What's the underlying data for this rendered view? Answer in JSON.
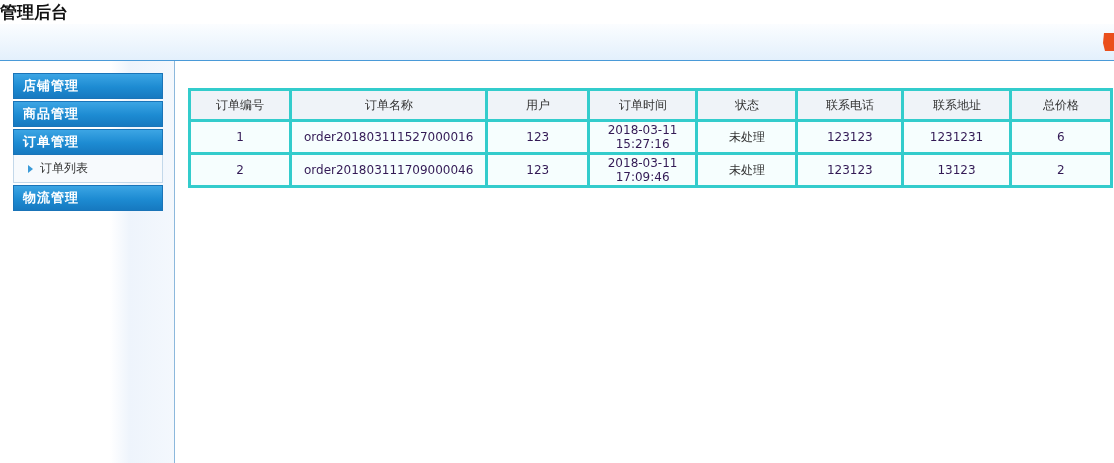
{
  "window": {
    "title": "管理后台"
  },
  "sidebar": {
    "groups": [
      {
        "label": "店铺管理"
      },
      {
        "label": "商品管理"
      },
      {
        "label": "订单管理",
        "children": [
          {
            "label": "订单列表"
          }
        ]
      },
      {
        "label": "物流管理"
      }
    ]
  },
  "table": {
    "columns": [
      "订单编号",
      "订单名称",
      "用户",
      "订单时间",
      "状态",
      "联系电话",
      "联系地址",
      "总价格"
    ],
    "rows": [
      [
        "1",
        "order201803111527000016",
        "123",
        "2018-03-11 15:27:16",
        "未处理",
        "123123",
        "1231231",
        "6"
      ],
      [
        "2",
        "order201803111709000046",
        "123",
        "2018-03-11 17:09:46",
        "未处理",
        "123123",
        "13123",
        "2"
      ]
    ]
  }
}
